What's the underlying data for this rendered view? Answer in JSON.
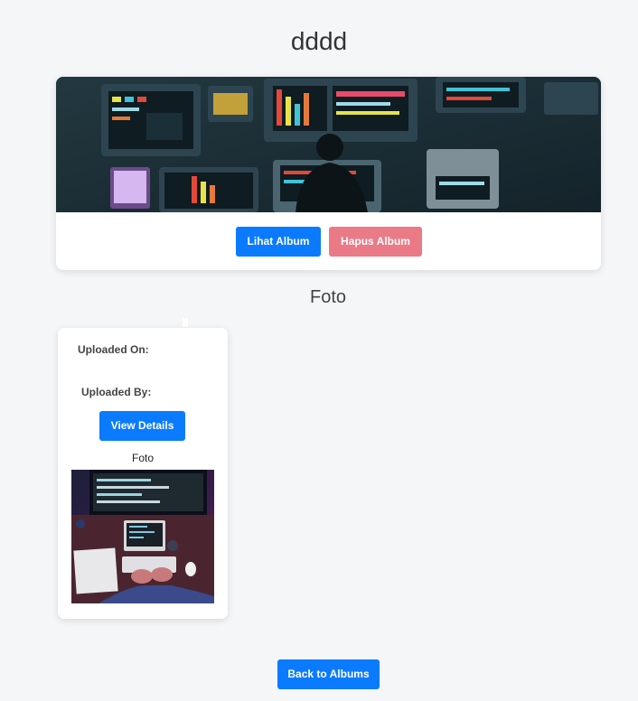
{
  "page": {
    "title": "dddd"
  },
  "album": {
    "view_label": "Lihat Album",
    "delete_label": "Hapus Album",
    "colors": {
      "primary": "#0a7bff",
      "danger": "#e97a86"
    }
  },
  "photos_section": {
    "title": "Foto"
  },
  "photo_card": {
    "uploaded_on_label": "Uploaded On:",
    "uploaded_by_label": "Uploaded By:",
    "view_details_label": "View Details",
    "caption": "Foto"
  },
  "footer": {
    "back_label": "Back to Albums"
  }
}
